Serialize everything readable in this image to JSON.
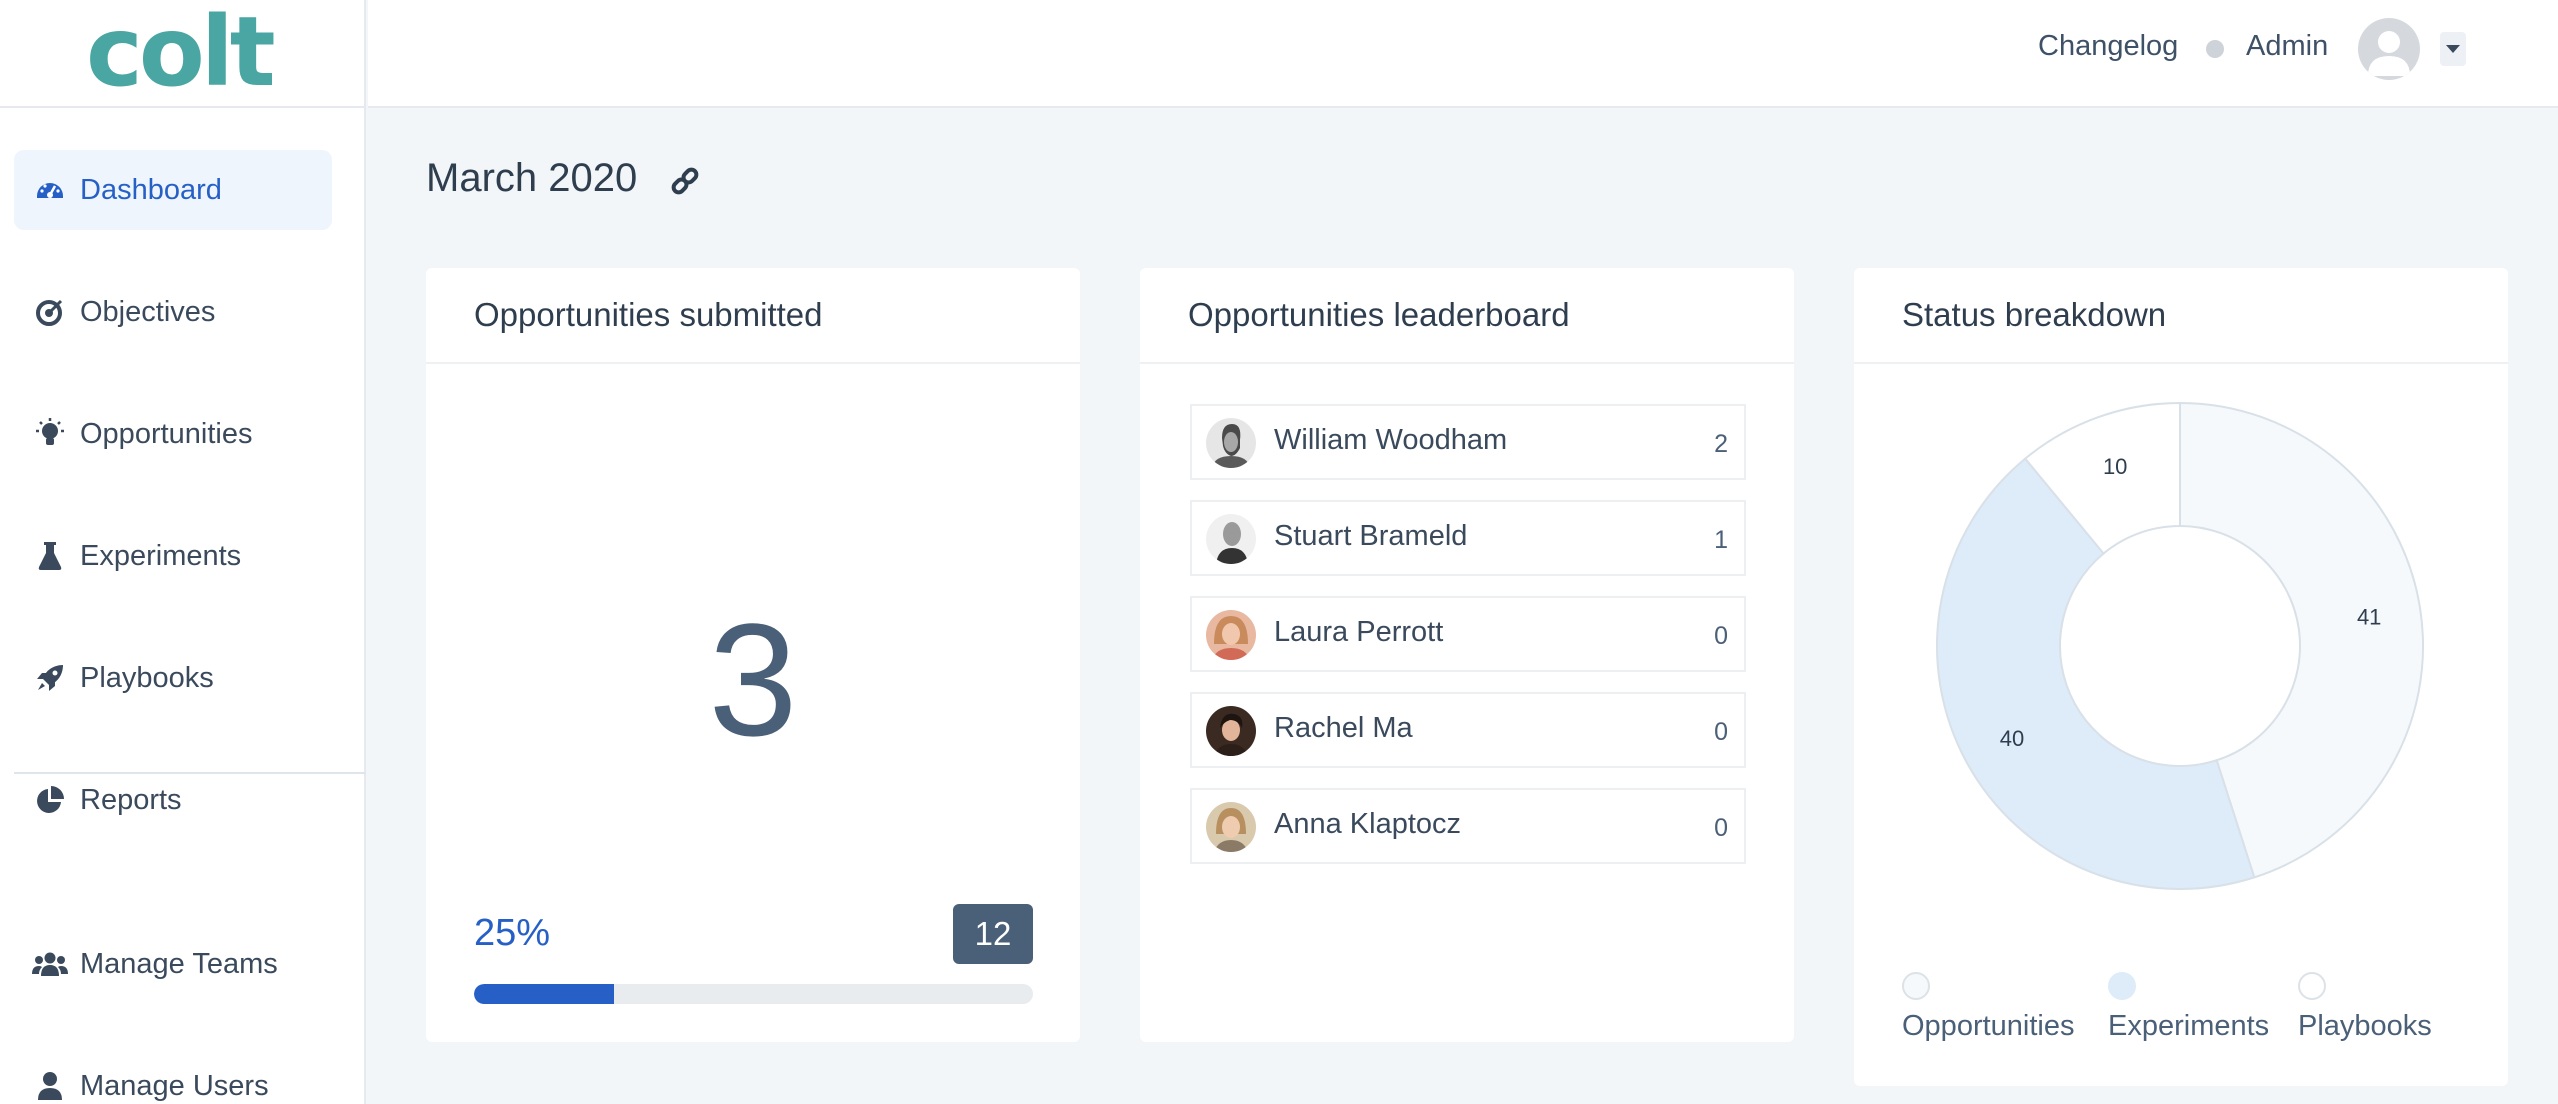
{
  "brand": {
    "logo_text": "colt",
    "logo_color": "#4aa6a2"
  },
  "sidebar": {
    "items": [
      {
        "label": "Dashboard",
        "icon": "gauge-icon",
        "active": true
      },
      {
        "label": "Objectives",
        "icon": "target-icon",
        "active": false
      },
      {
        "label": "Opportunities",
        "icon": "lightbulb-icon",
        "active": false
      },
      {
        "label": "Experiments",
        "icon": "flask-icon",
        "active": false
      },
      {
        "label": "Playbooks",
        "icon": "rocket-icon",
        "active": false
      },
      {
        "label": "Reports",
        "icon": "pie-chart-icon",
        "active": false
      },
      {
        "label": "Manage Teams",
        "icon": "users-icon",
        "active": false
      },
      {
        "label": "Manage Users",
        "icon": "user-icon",
        "active": false
      }
    ]
  },
  "header": {
    "changelog_label": "Changelog",
    "user_label": "Admin"
  },
  "page": {
    "title": "March 2020"
  },
  "cards": {
    "submitted": {
      "title": "Opportunities submitted",
      "count": "3",
      "percent_label": "25%",
      "progress_fraction": 0.25,
      "goal": "12"
    },
    "leaderboard": {
      "title": "Opportunities leaderboard",
      "rows": [
        {
          "name": "William Woodham",
          "score": "2"
        },
        {
          "name": "Stuart Brameld",
          "score": "1"
        },
        {
          "name": "Laura Perrott",
          "score": "0"
        },
        {
          "name": "Rachel Ma",
          "score": "0"
        },
        {
          "name": "Anna Klaptocz",
          "score": "0"
        }
      ]
    },
    "status": {
      "title": "Status breakdown"
    }
  },
  "colors": {
    "accent": "#2660c7",
    "dark": "#4a5f78"
  },
  "chart_data": {
    "type": "pie",
    "donut": true,
    "title": "Status breakdown",
    "categories": [
      "Opportunities",
      "Experiments",
      "Playbooks"
    ],
    "values": [
      41,
      40,
      10
    ],
    "colors": [
      "#f6f9fc",
      "#deebf8",
      "#ffffff"
    ],
    "legend": "bottom"
  }
}
